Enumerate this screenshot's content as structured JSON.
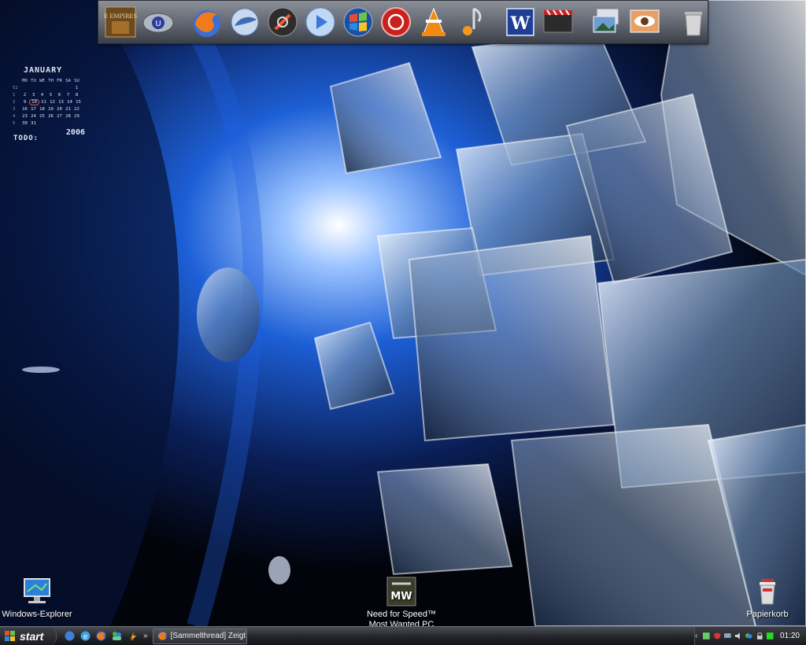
{
  "calendar": {
    "month": "JANUARY",
    "weekdays": [
      "MO",
      "TU",
      "WE",
      "TH",
      "FR",
      "SA",
      "SU"
    ],
    "weeks": [
      {
        "wk": "52",
        "days": [
          "",
          "",
          "",
          "",
          "",
          "",
          "1"
        ]
      },
      {
        "wk": "1",
        "days": [
          "2",
          "3",
          "4",
          "5",
          "6",
          "7",
          "8"
        ]
      },
      {
        "wk": "2",
        "days": [
          "9",
          "10",
          "11",
          "12",
          "13",
          "14",
          "15"
        ]
      },
      {
        "wk": "3",
        "days": [
          "16",
          "17",
          "18",
          "19",
          "20",
          "21",
          "22"
        ]
      },
      {
        "wk": "4",
        "days": [
          "23",
          "24",
          "25",
          "26",
          "27",
          "28",
          "29"
        ]
      },
      {
        "wk": "5",
        "days": [
          "30",
          "31",
          "",
          "",
          "",
          "",
          ""
        ]
      }
    ],
    "today": "10",
    "year": "2006"
  },
  "todo_label": "TODO:",
  "dock": {
    "aoe_text": "AGE EMPIRES III"
  },
  "desktop_icons": {
    "explorer": "Windows-Explorer",
    "nfs": "Need for Speed™ Most Wanted PC Demo",
    "nfs_badge": "MW",
    "recycle": "Papierkorb"
  },
  "taskbar": {
    "start_label": "start",
    "quicklaunch_more": "»",
    "task_label": "[Sammelthread] Zeigt...",
    "tray_chevron": "‹",
    "clock": "01:20"
  },
  "colors": {
    "accent_blue": "#2f6fe0",
    "today_ring": "#e0533f"
  }
}
